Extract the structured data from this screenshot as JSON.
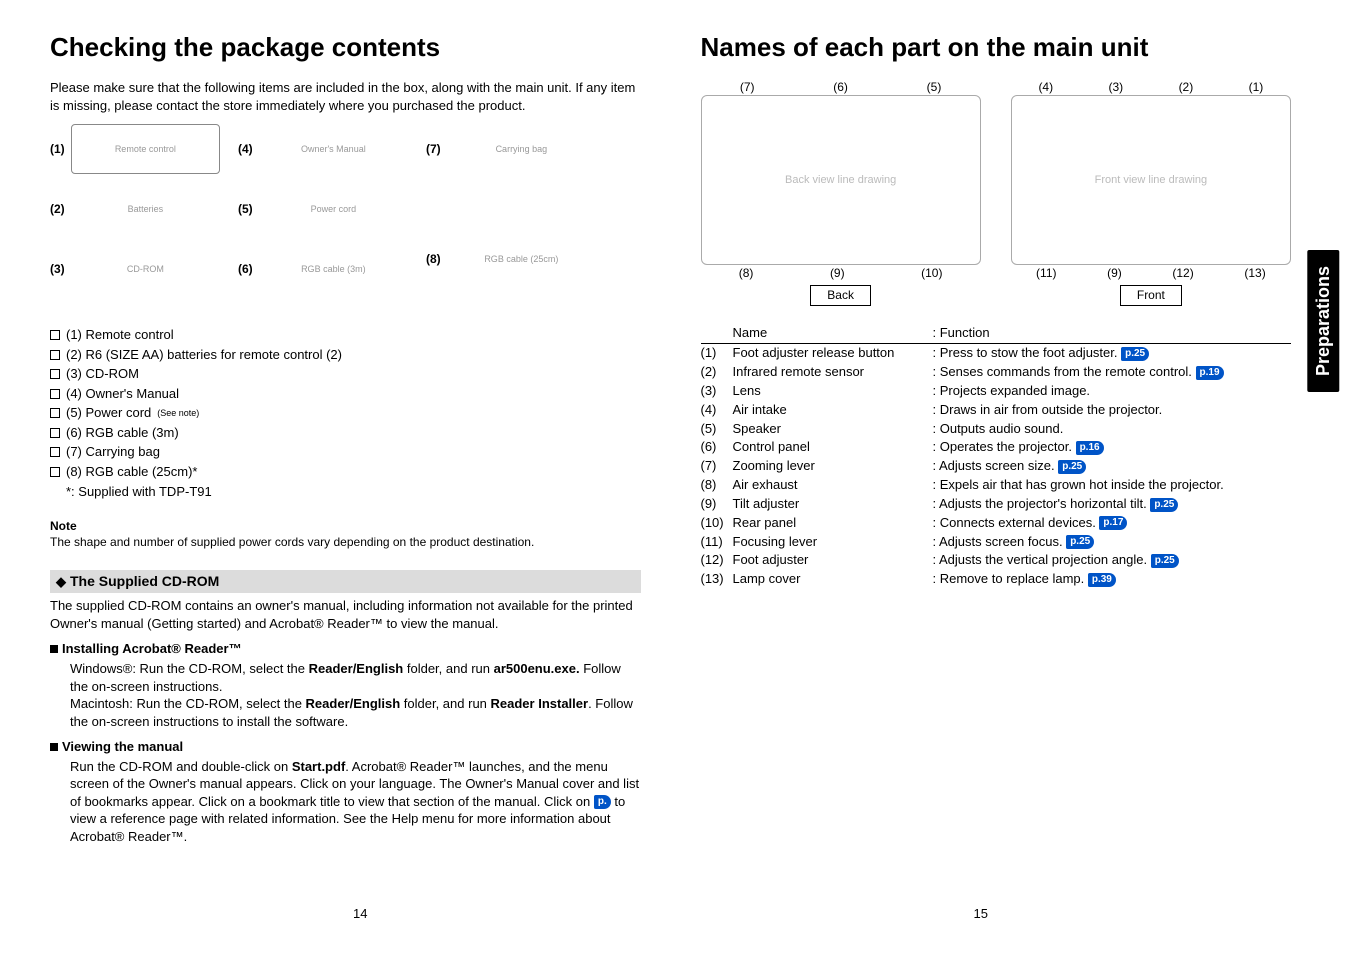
{
  "left": {
    "title": "Checking the package contents",
    "intro": "Please make sure that the following items are included in the box, along with the main unit. If any item is missing, please contact the store immediately where you purchased the product.",
    "gridLabels": [
      "(1)",
      "(2)",
      "(3)",
      "(4)",
      "(5)",
      "(6)",
      "(7)",
      "(8)"
    ],
    "gridAlts": [
      "Remote control",
      "Batteries",
      "CD-ROM",
      "Owner's Manual",
      "Power cord",
      "RGB cable (3m)",
      "Carrying bag",
      "RGB cable (25cm)"
    ],
    "checklist": [
      {
        "box": true,
        "text": "(1)  Remote control"
      },
      {
        "box": true,
        "text": "(2)  R6 (SIZE AA) batteries for remote control (2)"
      },
      {
        "box": true,
        "text": "(3)  CD-ROM"
      },
      {
        "box": true,
        "text": "(4)  Owner's Manual"
      },
      {
        "box": true,
        "text": "(5)  Power cord ",
        "sup": "(See note)"
      },
      {
        "box": true,
        "text": "(6)  RGB cable (3m)"
      },
      {
        "box": true,
        "text": "(7)  Carrying bag"
      },
      {
        "box": true,
        "text": "(8)  RGB cable (25cm)*"
      },
      {
        "box": false,
        "text": "*: Supplied with TDP-T91"
      }
    ],
    "noteHead": "Note",
    "noteText": "The shape and number of supplied power cords vary depending on the product destination.",
    "subTitle": "The Supplied CD-ROM",
    "subBody": "The supplied CD-ROM contains an owner's manual, including information not available for the printed Owner's manual (Getting started) and Acrobat® Reader™ to view the manual.",
    "install": {
      "head": "Installing Acrobat® Reader™",
      "body1a": "Windows®: Run the CD-ROM, select the ",
      "body1b": "Reader/English",
      "body1c": " folder, and run ",
      "body1d": "ar500enu.exe.",
      "body1e": " Follow the on-screen instructions.",
      "body2a": "Macintosh: Run the CD-ROM, select the ",
      "body2b": "Reader/English",
      "body2c": " folder, and run ",
      "body2d": "Reader Installer",
      "body2e": ". Follow the on-screen instructions to install the software."
    },
    "view": {
      "head": "Viewing the manual",
      "body_pre": "Run the CD-ROM and double-click on ",
      "start": "Start.pdf",
      "body_mid": ". Acrobat® Reader™ launches, and the menu screen of the Owner's manual appears. Click on your language. The Owner's Manual cover and list of bookmarks appear. Click on a bookmark title to view that section of the manual. Click on ",
      "badge": "p.",
      "body_post": " to view a reference page with related information. See the Help menu for more information about Acrobat® Reader™."
    }
  },
  "right": {
    "title": "Names of each part on the main unit",
    "leadersBackTop": [
      "(7)",
      "(6)",
      "(5)"
    ],
    "leadersBackBot": [
      "(8)",
      "(9)",
      "(10)"
    ],
    "leadersFrontTop": [
      "(4)",
      "(3)",
      "(2)",
      "(1)"
    ],
    "leadersFrontBot": [
      "(11)",
      "(9)",
      "(12)",
      "(13)"
    ],
    "backAlt": "Back view line drawing",
    "frontAlt": "Front view line drawing",
    "backLabel": "Back",
    "frontLabel": "Front",
    "headerName": "Name",
    "headerFunc": ": Function",
    "rows": [
      {
        "n": "(1)",
        "name": "Foot adjuster release button",
        "func": ": Press to stow the foot adjuster. ",
        "badge": "p.25"
      },
      {
        "n": "(2)",
        "name": "Infrared remote sensor",
        "func": ": Senses commands from the remote control. ",
        "badge": "p.19"
      },
      {
        "n": "(3)",
        "name": "Lens",
        "func": ": Projects expanded image."
      },
      {
        "n": "(4)",
        "name": "Air intake",
        "func": ": Draws in air from outside the projector."
      },
      {
        "n": "(5)",
        "name": "Speaker",
        "func": ": Outputs audio sound."
      },
      {
        "n": "(6)",
        "name": "Control panel",
        "func": ": Operates the projector. ",
        "badge": "p.16"
      },
      {
        "n": "(7)",
        "name": "Zooming lever",
        "func": ": Adjusts screen size. ",
        "badge": "p.25"
      },
      {
        "n": "(8)",
        "name": "Air exhaust",
        "func": ": Expels air that has grown hot inside the projector."
      },
      {
        "n": "(9)",
        "name": "Tilt adjuster",
        "func": ": Adjusts the projector's horizontal tilt. ",
        "badge": "p.25"
      },
      {
        "n": "(10)",
        "name": "Rear panel",
        "func": ": Connects external devices. ",
        "badge": "p.17"
      },
      {
        "n": "(11)",
        "name": "Focusing lever",
        "func": ": Adjusts screen focus. ",
        "badge": "p.25"
      },
      {
        "n": "(12)",
        "name": "Foot adjuster",
        "func": ": Adjusts the vertical projection angle. ",
        "badge": "p.25"
      },
      {
        "n": "(13)",
        "name": "Lamp cover",
        "func": ": Remove to replace lamp. ",
        "badge": "p.39"
      }
    ]
  },
  "sideTab": "Preparations",
  "pageLeft": "14",
  "pageRight": "15"
}
